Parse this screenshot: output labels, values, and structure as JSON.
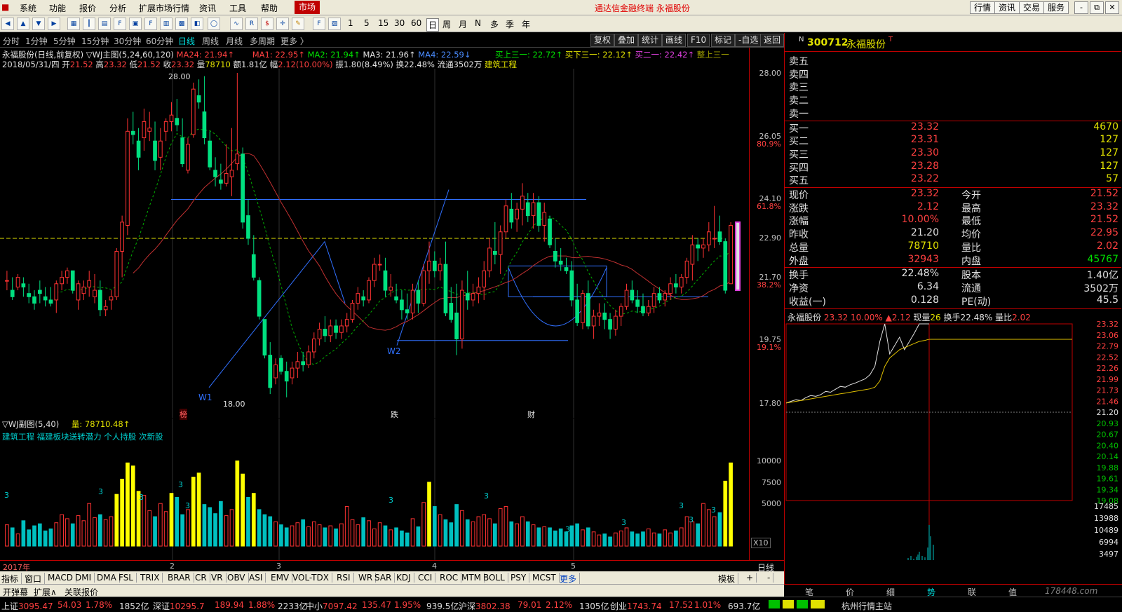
{
  "menu": {
    "items": [
      "系统",
      "功能",
      "报价",
      "分析",
      "扩展市场行情",
      "资讯",
      "工具",
      "帮助"
    ],
    "market": "市场",
    "title": "通达信金融终端  永福股份",
    "right_buttons": [
      "行情",
      "资讯",
      "交易",
      "服务"
    ],
    "win_buttons": [
      "-",
      "⧉",
      "✕"
    ]
  },
  "toolbar": {
    "numbers": [
      "1",
      "5",
      "15",
      "30",
      "60"
    ],
    "periods": [
      "日",
      "周",
      "月",
      "N",
      "多",
      "季",
      "年"
    ]
  },
  "periodbar": {
    "items": [
      "分时",
      "1分钟",
      "5分钟",
      "15分钟",
      "30分钟",
      "60分钟",
      "日线",
      "周线",
      "月线",
      "多周期",
      "更多 〉"
    ],
    "active": "日线",
    "right_buttons": [
      "复权",
      "叠加",
      "统计",
      "画线",
      "F10",
      "标记",
      "-自选",
      "返回"
    ]
  },
  "main": {
    "title": "永福股份(日线,前复权)",
    "indicator": "▽WJ主图(5,24,60,120)",
    "ma_a": "MA24: 21.94↑",
    "ma1": "MA1: 22.95↑",
    "ma2": "MA2: 21.94↑",
    "ma3": "MA3: 21.96↑",
    "ma4": "MA4: 22.59↓",
    "sig1": "买上三一: 22.72↑",
    "sig2": "买下三一: 22.12↑",
    "sig3": "买二一: 22.42↑",
    "sig4": "整上三一",
    "date": "2018/05/31/四",
    "open_label": "开",
    "open": "21.52",
    "high_label": "高",
    "high": "23.32",
    "low_label": "低",
    "low": "21.52",
    "close_label": "收",
    "close": "23.32",
    "vol_label": "量",
    "vol": "78710",
    "amt_label": "额",
    "amt": "1.81亿",
    "chg_label": "幅",
    "chg": "2.12(10.00%)",
    "amp_label": "振",
    "amp": "1.80(8.49%)",
    "turn_label": "换",
    "turn": "22.48%",
    "float_label": "流通",
    "float": "3502万",
    "sector": "建筑工程",
    "hi_label": "28.00",
    "lo_label": "18.00",
    "w1": "W1",
    "w2": "W2",
    "tag1": "榜",
    "tag2": "跌",
    "tag3": "财"
  },
  "axis": {
    "prices": [
      "28.00",
      "26.05",
      "80.9%",
      "24.10",
      "61.8%",
      "22.90",
      "21.70",
      "38.2%",
      "19.75",
      "19.1%",
      "17.80"
    ],
    "vol": [
      "10000",
      "7500",
      "5000"
    ],
    "x10": "X10",
    "dayline": "日线"
  },
  "sub": {
    "title": "▽WJ副图(5,40)",
    "vol_label": "量: 78710.48↑",
    "tags": "建筑工程 福建板块送转潜力 个人持股 次新股",
    "marks": [
      "3",
      "3",
      "3",
      "3",
      "3",
      "3",
      "3",
      "3",
      "3",
      "3",
      "3",
      "3"
    ]
  },
  "datebar": {
    "year": "2017年",
    "months": [
      "2",
      "3",
      "4",
      "5"
    ]
  },
  "tabs": {
    "items": [
      "指标",
      "窗口",
      "MACD",
      "DMI",
      "DMA",
      "FSL",
      "TRIX",
      "BRAR",
      "CR",
      "VR",
      "OBV",
      "ASI",
      "EMV",
      "VOL-TDX",
      "RSI",
      "WR",
      "SAR",
      "KDJ",
      "CCI",
      "ROC",
      "MTM",
      "BOLL",
      "PSY",
      "MCST",
      "更多"
    ],
    "right": [
      "模板",
      "+",
      "-"
    ]
  },
  "tabs2": {
    "items": [
      "开弹幕",
      "扩展∧",
      "关联报价"
    ]
  },
  "status": {
    "sh_label": "上证",
    "sh": "3095.47",
    "sh_chg": "54.03",
    "sh_pct": "1.78%",
    "sh_amt": "1852亿",
    "sz_label": "深证",
    "sz": "10295.7",
    "sz_chg": "189.94",
    "sz_pct": "1.88%",
    "sz_amt": "2233亿",
    "zx_label": "中小",
    "zx": "7097.42",
    "zx_chg": "135.47",
    "zx_pct": "1.95%",
    "zx_amt": "939.5亿",
    "hs_label": "沪深",
    "hs": "3802.38",
    "hs_chg": "79.01",
    "hs_pct": "2.12%",
    "hs_amt": "1305亿",
    "cy_label": "创业",
    "cy": "1743.74",
    "cy_chg": "17.52",
    "cy_pct": "1.01%",
    "cy_amt": "693.7亿",
    "site": "杭州行情主站"
  },
  "quote": {
    "badge": "N",
    "code": "300712",
    "name": "永福股份",
    "mark": "T",
    "asks": [
      {
        "label": "卖五",
        "price": "",
        "vol": ""
      },
      {
        "label": "卖四",
        "price": "",
        "vol": ""
      },
      {
        "label": "卖三",
        "price": "",
        "vol": ""
      },
      {
        "label": "卖二",
        "price": "",
        "vol": ""
      },
      {
        "label": "卖一",
        "price": "",
        "vol": ""
      }
    ],
    "bids": [
      {
        "label": "买一",
        "price": "23.32",
        "vol": "4670"
      },
      {
        "label": "买二",
        "price": "23.31",
        "vol": "127"
      },
      {
        "label": "买三",
        "price": "23.30",
        "vol": "127"
      },
      {
        "label": "买四",
        "price": "23.28",
        "vol": "127"
      },
      {
        "label": "买五",
        "price": "23.22",
        "vol": "57"
      }
    ],
    "stats": [
      {
        "l1": "现价",
        "v1": "23.32",
        "l2": "今开",
        "v2": "21.52"
      },
      {
        "l1": "涨跌",
        "v1": "2.12",
        "l2": "最高",
        "v2": "23.32"
      },
      {
        "l1": "涨幅",
        "v1": "10.00%",
        "l2": "最低",
        "v2": "21.52"
      },
      {
        "l1": "昨收",
        "v1": "21.20",
        "l2": "均价",
        "v2": "22.95"
      },
      {
        "l1": "总量",
        "v1": "78710",
        "l2": "量比",
        "v2": "2.02"
      },
      {
        "l1": "外盘",
        "v1": "32943",
        "l2": "内盘",
        "v2": "45767"
      }
    ],
    "stats2": [
      {
        "l1": "换手",
        "v1": "22.48%",
        "l2": "股本",
        "v2": "1.40亿"
      },
      {
        "l1": "净资",
        "v1": "6.34",
        "l2": "流通",
        "v2": "3502万"
      },
      {
        "l1": "收益(一)",
        "v1": "0.128",
        "l2": "PE(动)",
        "v2": "45.5"
      }
    ],
    "mini_header": {
      "name": "永福股份",
      "price": "23.32",
      "pct": "10.00%",
      "chg": "▲2.12",
      "vol_label": "现量",
      "vol": "26",
      "turn_label": "换手",
      "turn": "22.48%",
      "ratio_label": "量比",
      "ratio": "2.02"
    },
    "mini_axis": [
      "23.32",
      "23.06",
      "22.79",
      "22.52",
      "22.26",
      "21.99",
      "21.73",
      "21.46",
      "21.20",
      "20.93",
      "20.67",
      "20.40",
      "20.14",
      "19.88",
      "19.61",
      "19.34",
      "19.08"
    ],
    "mini_vol_axis": [
      "17485",
      "13988",
      "10489",
      "6994",
      "3497"
    ],
    "bottom_tabs": [
      "笔",
      "价",
      "细",
      "势",
      "联",
      "值"
    ],
    "watermark": "178448.com"
  },
  "chart_data": {
    "type": "candlestick",
    "ylim": [
      17.8,
      28.0
    ],
    "title": "永福股份(日线,前复权)",
    "candles": [
      [
        21.6,
        21.9,
        21.3,
        21.6
      ],
      [
        21.3,
        21.7,
        21.0,
        21.1
      ],
      [
        21.4,
        21.8,
        21.3,
        21.7
      ],
      [
        21.5,
        21.7,
        21.1,
        21.4
      ],
      [
        21.2,
        21.5,
        20.9,
        21.1
      ],
      [
        21.1,
        21.3,
        20.7,
        20.9
      ],
      [
        21.3,
        21.6,
        20.9,
        21.2
      ],
      [
        21.1,
        21.4,
        20.8,
        21.0
      ],
      [
        21.0,
        21.4,
        20.8,
        20.9
      ],
      [
        21.0,
        21.6,
        20.6,
        21.5
      ],
      [
        21.5,
        21.9,
        21.3,
        21.7
      ],
      [
        21.7,
        22.0,
        21.5,
        21.9
      ],
      [
        21.9,
        21.9,
        21.2,
        21.3
      ],
      [
        21.0,
        21.6,
        20.7,
        21.5
      ],
      [
        21.2,
        21.6,
        21.0,
        21.4
      ],
      [
        21.4,
        21.9,
        21.1,
        21.6
      ],
      [
        21.1,
        21.8,
        20.9,
        21.3
      ],
      [
        21.3,
        21.6,
        20.5,
        20.7
      ],
      [
        20.7,
        21.0,
        20.5,
        20.8
      ],
      [
        21.0,
        21.3,
        20.7,
        21.1
      ],
      [
        21.1,
        22.6,
        21.0,
        22.5
      ],
      [
        22.5,
        23.6,
        21.7,
        23.4
      ],
      [
        23.3,
        26.6,
        23.0,
        26.2
      ],
      [
        26.2,
        26.8,
        25.8,
        26.1
      ],
      [
        25.9,
        26.3,
        25.0,
        25.4
      ],
      [
        26.0,
        26.9,
        25.6,
        26.5
      ],
      [
        26.2,
        26.8,
        25.9,
        26.3
      ],
      [
        25.9,
        26.5,
        25.0,
        25.3
      ],
      [
        25.4,
        26.3,
        25.0,
        25.9
      ],
      [
        26.2,
        26.6,
        25.9,
        26.5
      ],
      [
        26.5,
        27.1,
        26.2,
        26.7
      ],
      [
        26.6,
        27.2,
        26.2,
        26.4
      ],
      [
        26.0,
        26.6,
        25.1,
        25.2
      ],
      [
        25.0,
        26.0,
        24.9,
        25.8
      ],
      [
        26.1,
        27.7,
        26.0,
        27.5
      ],
      [
        27.3,
        27.8,
        26.9,
        27.1
      ],
      [
        26.8,
        27.9,
        25.8,
        26.0
      ],
      [
        25.9,
        26.2,
        25.0,
        25.1
      ],
      [
        25.0,
        25.4,
        24.5,
        24.8
      ],
      [
        24.7,
        25.2,
        24.4,
        24.6
      ],
      [
        24.6,
        25.8,
        24.5,
        24.9
      ],
      [
        24.8,
        26.3,
        24.2,
        25.0
      ],
      [
        25.2,
        28.0,
        25.0,
        25.5
      ],
      [
        25.5,
        25.7,
        23.2,
        23.4
      ],
      [
        23.6,
        24.1,
        22.7,
        22.9
      ],
      [
        22.4,
        23.0,
        21.6,
        21.7
      ],
      [
        21.6,
        21.7,
        20.4,
        20.5
      ],
      [
        20.4,
        20.4,
        19.2,
        19.3
      ],
      [
        19.3,
        19.7,
        18.1,
        18.3
      ],
      [
        18.6,
        19.2,
        18.4,
        19.0
      ],
      [
        19.2,
        19.3,
        18.7,
        18.8
      ],
      [
        18.8,
        19.1,
        18.0,
        18.5
      ],
      [
        18.6,
        19.1,
        18.4,
        18.9
      ],
      [
        18.9,
        19.4,
        18.6,
        19.1
      ],
      [
        19.1,
        19.4,
        18.8,
        19.0
      ],
      [
        19.0,
        19.6,
        18.9,
        19.4
      ],
      [
        19.4,
        20.0,
        19.2,
        19.8
      ],
      [
        19.8,
        20.3,
        19.6,
        20.1
      ],
      [
        20.1,
        20.5,
        19.7,
        19.9
      ],
      [
        19.9,
        20.4,
        19.7,
        20.2
      ],
      [
        20.2,
        20.4,
        19.8,
        20.0
      ],
      [
        20.0,
        20.4,
        19.8,
        20.2
      ],
      [
        20.2,
        20.6,
        20.0,
        20.4
      ],
      [
        20.4,
        21.0,
        20.3,
        20.9
      ],
      [
        20.9,
        21.4,
        20.7,
        21.2
      ],
      [
        21.1,
        21.3,
        20.8,
        21.0
      ],
      [
        21.0,
        21.7,
        20.9,
        21.6
      ],
      [
        21.6,
        22.3,
        21.4,
        22.1
      ],
      [
        22.1,
        22.4,
        21.9,
        22.1
      ],
      [
        21.9,
        22.3,
        21.1,
        21.3
      ],
      [
        21.3,
        21.8,
        21.1,
        21.4
      ],
      [
        21.1,
        21.5,
        20.9,
        21.0
      ],
      [
        21.0,
        21.3,
        20.4,
        20.7
      ],
      [
        20.7,
        21.2,
        20.4,
        20.6
      ],
      [
        20.6,
        21.5,
        20.4,
        21.3
      ],
      [
        21.3,
        21.6,
        20.6,
        20.9
      ],
      [
        20.9,
        22.1,
        20.8,
        21.9
      ],
      [
        21.9,
        22.8,
        21.5,
        22.2
      ],
      [
        22.2,
        22.5,
        21.7,
        21.9
      ],
      [
        21.9,
        22.3,
        21.6,
        22.1
      ],
      [
        22.1,
        22.8,
        20.5,
        20.6
      ],
      [
        20.9,
        21.4,
        20.3,
        20.4
      ],
      [
        20.6,
        21.5,
        19.3,
        19.8
      ],
      [
        19.8,
        21.6,
        19.5,
        21.3
      ],
      [
        21.2,
        21.9,
        20.7,
        21.0
      ],
      [
        21.0,
        21.5,
        20.8,
        21.2
      ],
      [
        21.2,
        21.7,
        20.9,
        21.4
      ],
      [
        21.4,
        22.2,
        21.0,
        21.9
      ],
      [
        21.9,
        22.9,
        21.7,
        22.6
      ],
      [
        22.5,
        23.4,
        22.1,
        22.4
      ],
      [
        22.4,
        23.3,
        21.8,
        23.1
      ],
      [
        23.1,
        24.1,
        22.9,
        23.9
      ],
      [
        23.8,
        24.3,
        23.2,
        23.4
      ],
      [
        23.5,
        24.0,
        23.1,
        23.8
      ],
      [
        23.8,
        24.6,
        23.3,
        24.2
      ],
      [
        24.0,
        24.3,
        23.4,
        23.6
      ],
      [
        23.6,
        24.3,
        23.2,
        24.0
      ],
      [
        24.0,
        24.2,
        23.1,
        23.3
      ],
      [
        23.3,
        24.0,
        22.8,
        23.7
      ],
      [
        23.5,
        23.6,
        22.6,
        22.7
      ],
      [
        22.5,
        22.9,
        22.0,
        22.2
      ],
      [
        22.2,
        22.6,
        21.9,
        22.1
      ],
      [
        22.0,
        22.3,
        21.8,
        21.9
      ],
      [
        21.9,
        22.2,
        20.8,
        21.0
      ],
      [
        21.0,
        21.5,
        20.2,
        20.3
      ],
      [
        20.3,
        21.3,
        20.1,
        21.2
      ],
      [
        21.2,
        21.6,
        20.1,
        20.2
      ],
      [
        20.2,
        20.7,
        19.8,
        20.5
      ],
      [
        20.5,
        20.9,
        20.2,
        20.6
      ],
      [
        20.6,
        20.9,
        20.1,
        20.4
      ],
      [
        20.4,
        20.6,
        19.8,
        20.1
      ],
      [
        20.1,
        20.7,
        19.9,
        20.5
      ],
      [
        20.5,
        20.9,
        20.2,
        20.8
      ],
      [
        20.8,
        21.5,
        20.7,
        21.3
      ],
      [
        21.3,
        21.6,
        20.9,
        21.0
      ],
      [
        21.0,
        21.3,
        20.6,
        20.8
      ],
      [
        20.8,
        21.2,
        20.5,
        20.6
      ],
      [
        20.6,
        21.0,
        20.5,
        20.8
      ],
      [
        20.8,
        21.4,
        20.6,
        21.2
      ],
      [
        21.2,
        21.4,
        20.9,
        21.0
      ],
      [
        21.0,
        21.3,
        20.8,
        21.2
      ],
      [
        21.2,
        21.7,
        21.0,
        21.5
      ],
      [
        21.5,
        21.8,
        21.2,
        21.4
      ],
      [
        21.4,
        21.8,
        21.2,
        21.7
      ],
      [
        21.7,
        22.3,
        21.5,
        22.2
      ],
      [
        22.1,
        23.0,
        21.6,
        22.7
      ],
      [
        22.7,
        22.9,
        22.2,
        22.6
      ],
      [
        22.6,
        22.9,
        22.3,
        22.7
      ],
      [
        22.7,
        23.4,
        22.5,
        23.1
      ],
      [
        22.9,
        23.9,
        22.6,
        22.9
      ],
      [
        23.1,
        23.6,
        22.7,
        22.8
      ],
      [
        22.8,
        22.9,
        21.2,
        21.3
      ],
      [
        21.5,
        23.4,
        21.5,
        23.3
      ]
    ],
    "volume": [
      2100,
      1800,
      1200,
      2500,
      1600,
      2000,
      2200,
      1500,
      1700,
      2300,
      3100,
      2700,
      2200,
      3000,
      2500,
      4200,
      2800,
      3100,
      2600,
      2900,
      5100,
      6600,
      8200,
      7900,
      5400,
      5000,
      3500,
      2900,
      4200,
      3400,
      5200,
      4800,
      3100,
      3600,
      6800,
      7200,
      4100,
      3800,
      3200,
      4400,
      3000,
      3600,
      8400,
      7100,
      4800,
      5200,
      3600,
      3100,
      2900,
      2400,
      2100,
      1800,
      2000,
      2300,
      2600,
      1900,
      2400,
      2100,
      1800,
      2000,
      1700,
      2200,
      3900,
      2600,
      2100,
      2800,
      2500,
      1700,
      2300,
      2000,
      1600,
      1800,
      1500,
      1300,
      2700,
      1900,
      4300,
      6300,
      3900,
      3100,
      2600,
      2300,
      4100,
      3500,
      2600,
      2400,
      2900,
      3100,
      2700,
      2200,
      3700,
      3900,
      2400,
      2200,
      2900,
      2400,
      2100,
      1800,
      1900,
      1800,
      1500,
      1700,
      1400,
      2000,
      2200,
      1600,
      1800,
      1400,
      1100,
      1200,
      900,
      1300,
      1500,
      1800,
      1400,
      1200,
      1400,
      1700,
      1300,
      1200,
      1600,
      1300,
      1500,
      1800,
      2900,
      2400,
      2200,
      4200,
      3600,
      2900,
      3300,
      6400,
      8200
    ]
  },
  "colors": {
    "up": "#ff3232",
    "down": "#00e080",
    "ma_white": "#e0e0e0",
    "ma_yellow": "#ffff00",
    "ma_green": "#00c800",
    "ma_red": "#e03030",
    "blue_line": "#3070ff",
    "panel_border": "#c00000"
  }
}
